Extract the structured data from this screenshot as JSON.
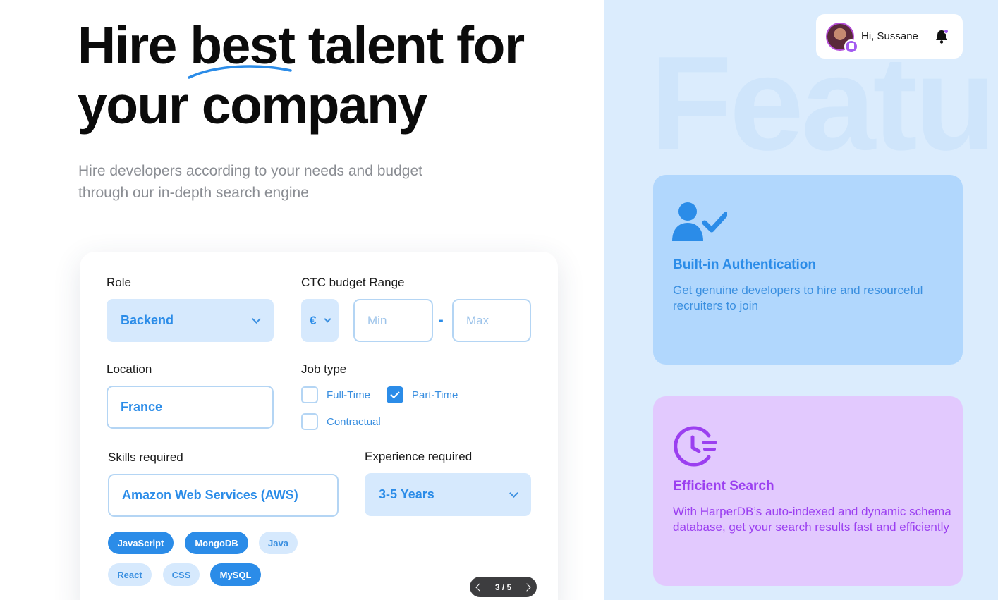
{
  "hero": {
    "title_a": "Hire ",
    "title_highlight": "best",
    "title_b": " talent for your company",
    "subtitle": "Hire developers according to your needs and budget through our in-depth search engine"
  },
  "form": {
    "role_label": "Role",
    "role_value": "Backend",
    "ctc_label": "CTC budget Range",
    "currency": "€",
    "min_placeholder": "Min",
    "max_placeholder": "Max",
    "range_separator": "-",
    "location_label": "Location",
    "location_value": "France",
    "job_type_label": "Job type",
    "job_types": [
      {
        "label": "Full-Time",
        "checked": false
      },
      {
        "label": "Part-Time",
        "checked": true
      },
      {
        "label": "Contractual",
        "checked": false
      }
    ],
    "skills_label": "Skills required",
    "skills_value": "Amazon Web Services (AWS)",
    "experience_label": "Experience required",
    "experience_value": "3-5 Years",
    "chips": [
      {
        "label": "JavaScript",
        "active": true
      },
      {
        "label": "MongoDB",
        "active": true
      },
      {
        "label": "Java",
        "active": false
      },
      {
        "label": "React",
        "active": false
      },
      {
        "label": "CSS",
        "active": false
      },
      {
        "label": "MySQL",
        "active": true
      }
    ],
    "pager": "3 / 5"
  },
  "header": {
    "greeting": "Hi, Sussane"
  },
  "features": {
    "bg_word": "Features",
    "items": [
      {
        "title": "Built-in Authentication",
        "desc": "Get genuine developers to hire and resourceful recruiters to join",
        "icon": "user-check-icon"
      },
      {
        "title": "Efficient Search",
        "desc": "With HarperDB’s auto-indexed and dynamic schema database, get your search results fast and efficiently",
        "icon": "clock-search-icon"
      }
    ]
  },
  "colors": {
    "accent": "#2b8ce8",
    "purple": "#9b3ff0",
    "right_bg": "#dbecfd"
  }
}
